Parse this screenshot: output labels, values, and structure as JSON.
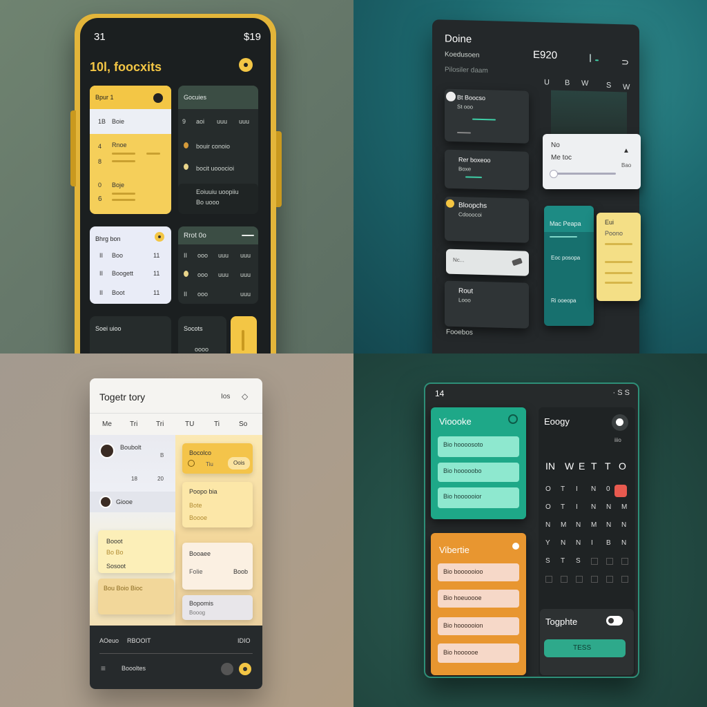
{
  "q1": {
    "status_left": "31",
    "status_right": "$19",
    "title": "10l, foocxits",
    "card1": {
      "header": "Bpur 1",
      "rows": [
        "Boie",
        "Rnoe",
        "Boje"
      ],
      "nums": [
        "1B",
        "4",
        "8",
        "0",
        "6"
      ]
    },
    "card2": {
      "header": "Gocuies",
      "cols": [
        "aoi",
        "uuu",
        "uuu"
      ],
      "rows": [
        "bouir conoio",
        "bocit uooocioi",
        "Eoiuuiu uoopiiu",
        "Bo uooo"
      ]
    },
    "card3": {
      "header": "Bhrg bon",
      "rows": [
        "Boo",
        "Boogett",
        "Boot"
      ],
      "nums": [
        "11",
        "11",
        "11"
      ]
    },
    "card4": {
      "header": "Rrot 0o"
    },
    "card5": {
      "header": "Soei uioo"
    },
    "card6": {
      "header": "Socots"
    },
    "accent": "#f3c645"
  },
  "q2": {
    "title": "Doine",
    "subtitle1": "Koedusoen",
    "subtitle2": "Pilosiler daam",
    "clock": "E920",
    "days": [
      "U",
      "B",
      "W",
      "S",
      "W"
    ],
    "cards": [
      {
        "title": "Bt Boocso",
        "sub": "St ooo"
      },
      {
        "title": "Rer boxeoo",
        "sub": "Boxe"
      },
      {
        "title": "Bloopchs",
        "sub": "Cdooocoi"
      },
      {
        "title": "Nc..."
      },
      {
        "title": "Rout",
        "sub": "Looo"
      }
    ],
    "dialog": {
      "title": "No",
      "sub": "Me toc",
      "right": "Bao"
    },
    "teal_card": {
      "title": "Mac Peapa",
      "rows": [
        "Eoc posopa",
        "Ri ooeopa"
      ]
    },
    "yellow_card": {
      "title": "Eui",
      "sub": "Poono"
    },
    "footer": "Fooebos",
    "accent": "#f4c542"
  },
  "q3": {
    "title": "Togetr tory",
    "top_right": "Ios",
    "days": [
      "Me",
      "Tri",
      "Tri",
      "TU",
      "Ti",
      "So"
    ],
    "items": [
      {
        "title": "Boubolt",
        "right": "B"
      },
      {
        "title": "Giooe"
      },
      {
        "nums": [
          "18",
          "20"
        ]
      }
    ],
    "notes": [
      {
        "title": "Bocolco",
        "badge": "Oois",
        "sub": "Tiu"
      },
      {
        "title": "Poopo bia",
        "sub": "Bote",
        "extra": "Boooe"
      },
      {
        "title": "Booot",
        "sub": "Bo Bo",
        "foot": "Sosoot"
      },
      {
        "title": "Booaee",
        "sub": "Folie",
        "right": "Boob"
      },
      {
        "title": "Bou Boio Bioc"
      },
      {
        "title": "Bopomis",
        "sub": "Booog"
      }
    ],
    "footer": {
      "left": "AOeuo",
      "mid": "RBOOIT",
      "right": "IDIO",
      "bottom": "Boooltes"
    }
  },
  "q4": {
    "status_left": "14",
    "status_right": "· S S",
    "green_card": {
      "title": "Vioooke",
      "items": [
        "Bio hoooosoto",
        "Bio hooooobo",
        "Bio hoooooior"
      ]
    },
    "orange_card": {
      "title": "Vibertie",
      "items": [
        "Bio boooooioo",
        "Bio hoeuoooe",
        "Bio hoooooion",
        "Bio hoooooe"
      ]
    },
    "calendar": {
      "title": "Eoogy",
      "sub": "iiio",
      "header": [
        "IN",
        "W",
        "E",
        "T",
        "T",
        "O"
      ]
    },
    "toggle": {
      "title": "Togphte",
      "button": "TESS"
    },
    "accent_teal": "#1fa68a",
    "accent_orange": "#e89630"
  }
}
